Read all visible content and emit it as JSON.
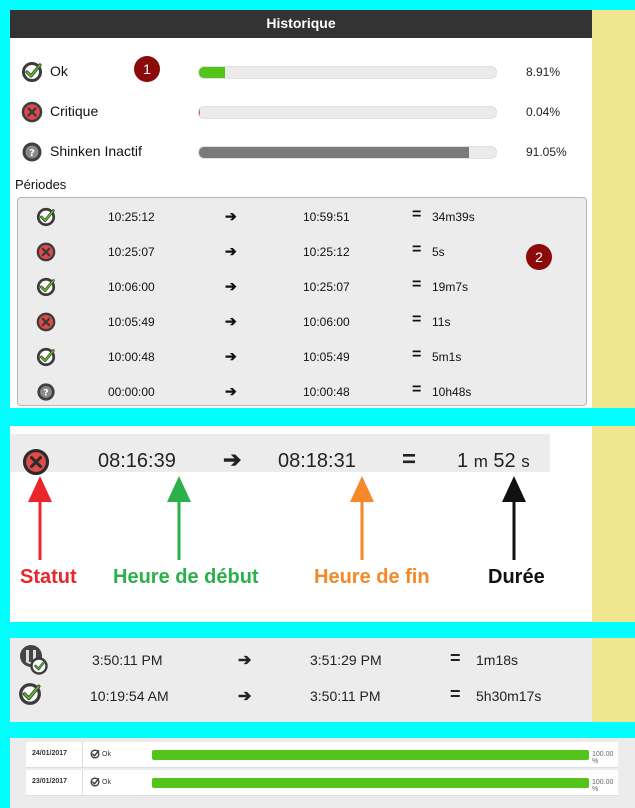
{
  "history": {
    "title": "Historique",
    "badge1": "1",
    "badge2": "2",
    "stats": [
      {
        "label": "Ok",
        "percent": "8.91%",
        "fill": 0.0891,
        "color": "#52c41a",
        "status": "ok"
      },
      {
        "label": "Critique",
        "percent": "0.04%",
        "fill": 0.0004,
        "color": "#e04a4a",
        "status": "critical"
      },
      {
        "label": "Shinken Inactif",
        "percent": "91.05%",
        "fill": 0.9105,
        "color": "#7a7a7a",
        "status": "unknown"
      }
    ],
    "periods_label": "Périodes",
    "periods": [
      {
        "status": "ok",
        "start": "10:25:12",
        "end": "10:59:51",
        "duration": "34m39s"
      },
      {
        "status": "critical",
        "start": "10:25:07",
        "end": "10:25:12",
        "duration": "5s"
      },
      {
        "status": "ok",
        "start": "10:06:00",
        "end": "10:25:07",
        "duration": "19m7s"
      },
      {
        "status": "critical",
        "start": "10:05:49",
        "end": "10:06:00",
        "duration": "11s"
      },
      {
        "status": "ok",
        "start": "10:00:48",
        "end": "10:05:49",
        "duration": "5m1s"
      },
      {
        "status": "unknown",
        "start": "00:00:00",
        "end": "10:00:48",
        "duration": "10h48s"
      }
    ]
  },
  "example": {
    "start": "08:16:39",
    "end": "08:18:31",
    "duration_num1": "1",
    "duration_unit1": "m",
    "duration_num2": "52",
    "duration_unit2": "s",
    "legend": {
      "status": "Statut",
      "start": "Heure de début",
      "end": "Heure de fin",
      "duration": "Durée"
    },
    "colors": {
      "status": "#e8262b",
      "start": "#2cb04a",
      "end": "#f5892a",
      "duration": "#111111"
    }
  },
  "timeline": [
    {
      "status": "maintenance-ok",
      "start": "3:50:11 PM",
      "end": "3:51:29 PM",
      "duration": "1m18s"
    },
    {
      "status": "ok",
      "start": "10:19:54 AM",
      "end": "3:50:11 PM",
      "duration": "5h30m17s"
    }
  ],
  "daily": [
    {
      "date": "24/01/2017",
      "status_label": "Ok",
      "percent": "100.00 %",
      "fill": 1.0
    },
    {
      "date": "23/01/2017",
      "status_label": "Ok",
      "percent": "100.00 %",
      "fill": 1.0
    }
  ],
  "icons": {
    "ok": "check-circle-icon",
    "critical": "x-circle-icon",
    "unknown": "question-circle-icon",
    "arrow": "arrow-right-icon",
    "maintenance": "wrench-overlay-icon"
  }
}
